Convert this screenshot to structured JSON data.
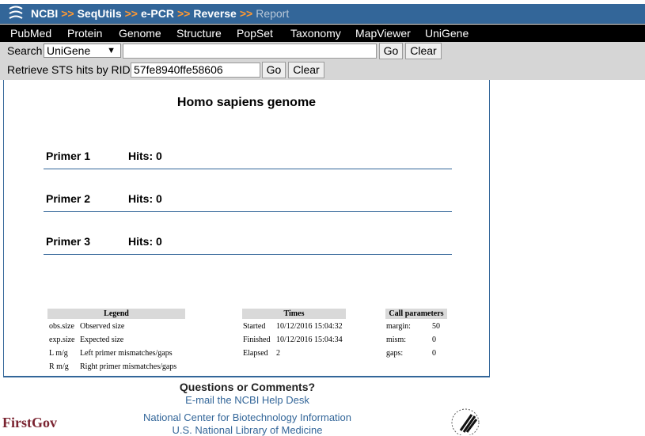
{
  "breadcrumb": {
    "items": [
      "NCBI",
      "SeqUtils",
      "e-PCR",
      "Reverse"
    ],
    "current": "Report",
    "separator": ">>"
  },
  "nav": {
    "items": [
      "PubMed",
      "Protein",
      "Genome",
      "Structure",
      "PopSet",
      "Taxonomy",
      "MapViewer",
      "UniGene"
    ]
  },
  "search": {
    "label": "Search",
    "database": "UniGene",
    "query": "",
    "go_label": "Go",
    "clear_label": "Clear"
  },
  "rid": {
    "label": "Retrieve STS hits by RID:",
    "value": "57fe8940ffe58606",
    "go_label": "Go",
    "clear_label": "Clear"
  },
  "report": {
    "title": "Homo sapiens genome",
    "primers": [
      {
        "name": "Primer 1",
        "hits": "Hits: 0"
      },
      {
        "name": "Primer 2",
        "hits": "Hits: 0"
      },
      {
        "name": "Primer 3",
        "hits": "Hits: 0"
      }
    ]
  },
  "legend": {
    "header": "Legend",
    "rows": [
      {
        "key": "obs.size",
        "desc": "Observed size"
      },
      {
        "key": "exp.size",
        "desc": "Expected size"
      },
      {
        "key": "L m/g",
        "desc": "Left primer mismatches/gaps"
      },
      {
        "key": "R m/g",
        "desc": "Right primer mismatches/gaps"
      }
    ]
  },
  "times": {
    "header": "Times",
    "rows": [
      {
        "key": "Started",
        "value": "10/12/2016 15:04:32"
      },
      {
        "key": "Finished",
        "value": "10/12/2016 15:04:34"
      },
      {
        "key": "Elapsed",
        "value": "2"
      }
    ]
  },
  "params": {
    "header": "Call parameters",
    "rows": [
      {
        "key": "margin:",
        "value": "50"
      },
      {
        "key": "mism:",
        "value": "0"
      },
      {
        "key": "gaps:",
        "value": "0"
      }
    ]
  },
  "footer": {
    "question": "Questions or Comments?",
    "helpdesk": "E-mail the NCBI Help Desk",
    "center": "National Center for Biotechnology Information",
    "nlm": "U.S. National Library of Medicine",
    "firstgov": "FirstGov"
  },
  "colors": {
    "header_blue": "#336699",
    "separator_orange": "#ff9933",
    "nav_black": "#000000",
    "bar_gray": "#d6d6d6"
  }
}
